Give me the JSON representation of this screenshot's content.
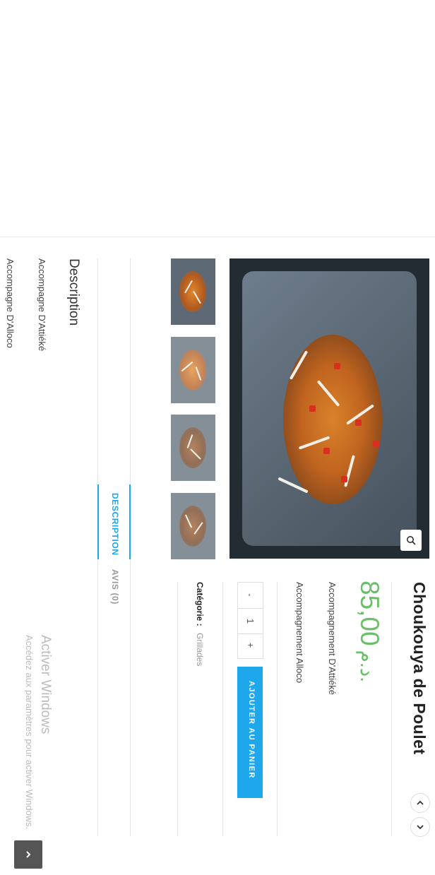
{
  "product": {
    "title": "Choukouya de Poulet",
    "price_value": "85,00",
    "price_currency": "د.م.",
    "accompaniments": [
      "Accompagnement D'Attiéké",
      "Accompagnement Alloco"
    ],
    "quantity": {
      "minus": "-",
      "value": "1",
      "plus": "+"
    },
    "add_to_cart_label": "AJOUTER AU PANIER",
    "category_label": "Catégorie :",
    "category_value": "Grillades"
  },
  "tabs": [
    {
      "label": "DESCRIPTION",
      "active": true
    },
    {
      "label": "AVIS (0)",
      "active": false
    }
  ],
  "description": {
    "heading": "Description",
    "lines": [
      "Accompagne D'Attiéké",
      "Accompagne D'Alloco"
    ]
  },
  "windows_watermark": {
    "title": "Activer Windows",
    "subtitle": "Accédez aux paramètres pour activer Windows."
  },
  "icons": {
    "zoom": "magnifier-icon",
    "prev": "chevron-up-icon",
    "next": "chevron-down-icon",
    "scroll_top": "chevron-right-icon"
  },
  "colors": {
    "accent": "#1ea7ea",
    "price": "#6abf69",
    "title": "#222222"
  }
}
